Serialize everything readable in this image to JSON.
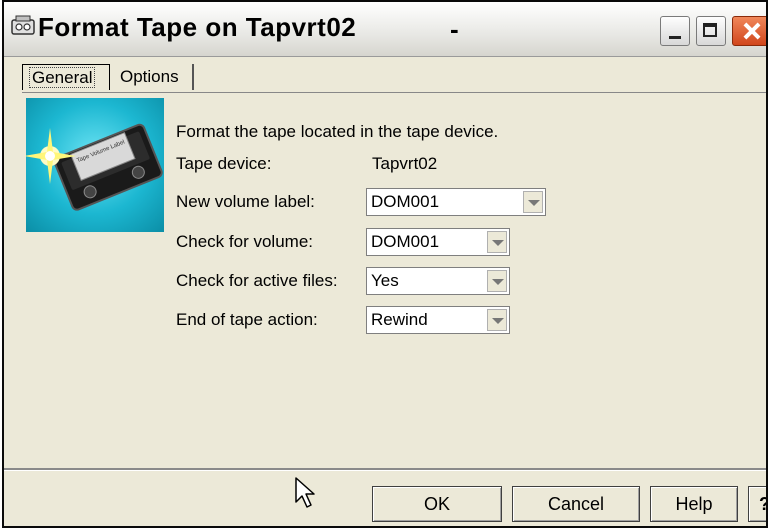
{
  "window": {
    "title": "Format Tape on Tapvrt02",
    "title_suffix": "-",
    "icon": "tape-icon"
  },
  "tabs": [
    {
      "label": "General",
      "selected": true
    },
    {
      "label": "Options",
      "selected": false
    }
  ],
  "illustration": {
    "label": "Tape Volume Label",
    "icon": "tape-cartridge-icon"
  },
  "form": {
    "description": "Format the tape located in the tape device.",
    "tape_device": {
      "label": "Tape device:",
      "value": "Tapvrt02"
    },
    "new_volume_label": {
      "label": "New volume label:",
      "value": "DOM001"
    },
    "check_for_volume": {
      "label": "Check for volume:",
      "value": "DOM001"
    },
    "check_for_active_files": {
      "label": "Check for active files:",
      "value": "Yes"
    },
    "end_of_tape_action": {
      "label": "End of tape action:",
      "value": "Rewind"
    }
  },
  "buttons": {
    "ok": "OK",
    "cancel": "Cancel",
    "help": "Help",
    "whats_this": "?"
  },
  "colors": {
    "window_bg": "#ece9d8",
    "close_button": "#d1461c",
    "illustration_bg": "#1cb7d1"
  }
}
